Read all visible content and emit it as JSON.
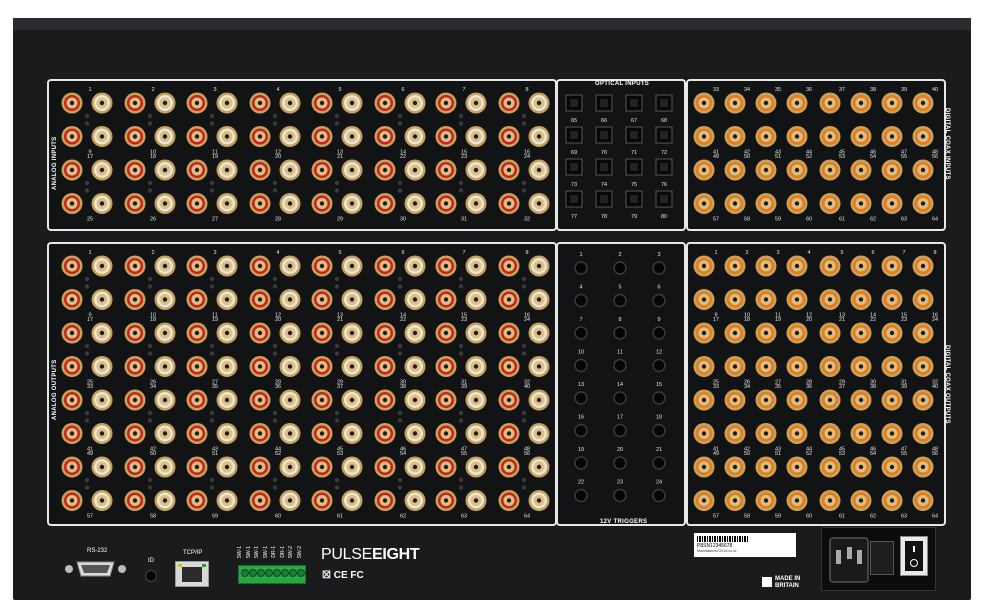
{
  "panels": {
    "analog_inputs": {
      "title": "ANALOG INPUTS",
      "pairs": 32
    },
    "optical_inputs": {
      "title": "OPTICAL INPUTS",
      "start": 65,
      "end": 80
    },
    "digital_coax_inputs": {
      "title": "DIGITAL COAX INPUTS",
      "start": 33,
      "end": 64
    },
    "analog_outputs": {
      "title": "ANALOG OUTPUTS",
      "pairs": 64
    },
    "triggers": {
      "title": "12V TRIGGERS",
      "count": 24
    },
    "digital_coax_outputs": {
      "title": "DIGITAL COAX OUTPUTS",
      "count": 64
    }
  },
  "bottom": {
    "rs232": "RS-232",
    "id": "ID",
    "tcpip": "TCP/IP",
    "sw_labels": [
      "SW-1",
      "SW-1",
      "SW-1",
      "SW-1",
      "DR-1",
      "DR-1",
      "SW-2",
      "SW-2"
    ],
    "brand_light": "PULSE",
    "brand_bold": "EIGHT",
    "certs": "☒ CE FC",
    "serial": "P8SN12345678",
    "serial_sub": "Manufactured 2014-xx-xx",
    "made_in": "MADE IN",
    "britain": "BRITAIN"
  },
  "colors": {
    "red": "#c8231b",
    "white": "#e9e6dc",
    "orange": "#e77a1a",
    "gold": "#c9a35a"
  }
}
